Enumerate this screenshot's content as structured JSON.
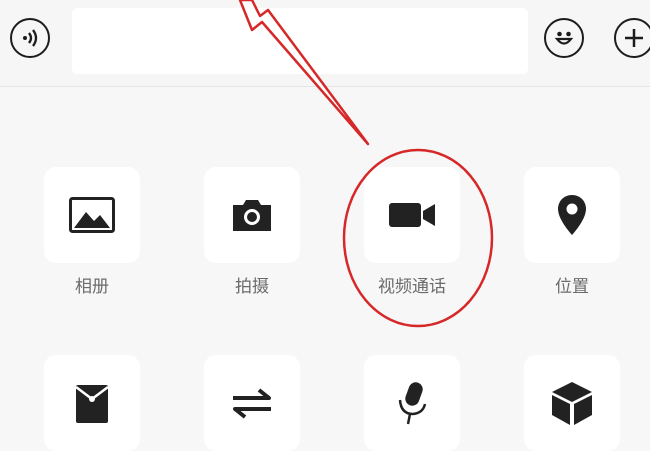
{
  "input_bar": {
    "voice_icon": "voice-wave-icon",
    "text_value": "",
    "emoji_icon": "smiley-icon",
    "more_icon": "plus-icon"
  },
  "panel": {
    "row1": [
      {
        "label": "相册",
        "icon": "image-icon"
      },
      {
        "label": "拍摄",
        "icon": "camera-icon"
      },
      {
        "label": "视频通话",
        "icon": "video-camera-icon"
      },
      {
        "label": "位置",
        "icon": "location-pin-icon"
      }
    ],
    "row2": [
      {
        "label": "",
        "icon": "red-packet-icon"
      },
      {
        "label": "",
        "icon": "transfer-icon"
      },
      {
        "label": "",
        "icon": "microphone-icon"
      },
      {
        "label": "",
        "icon": "cube-icon"
      }
    ]
  },
  "annotation": {
    "color": "#d62828"
  }
}
